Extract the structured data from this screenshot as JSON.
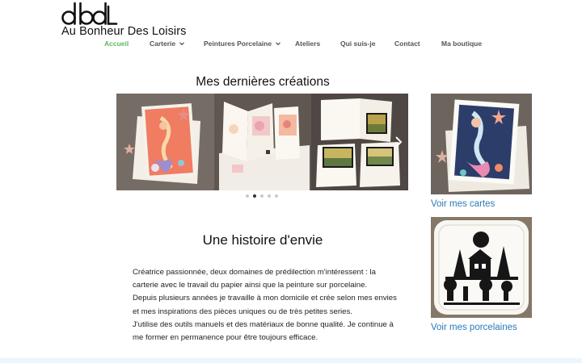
{
  "brand": {
    "logo_mark": "dbdL",
    "name": "Au Bonheur Des Loisirs"
  },
  "nav": {
    "items": [
      {
        "label": "Accueil",
        "active": true,
        "has_dropdown": false
      },
      {
        "label": "Carterie",
        "active": false,
        "has_dropdown": true
      },
      {
        "label": "Peintures Porcelaine",
        "active": false,
        "has_dropdown": true
      },
      {
        "label": "Ateliers",
        "active": false,
        "has_dropdown": false
      },
      {
        "label": "Qui suis-je",
        "active": false,
        "has_dropdown": false
      },
      {
        "label": "Contact",
        "active": false,
        "has_dropdown": false
      },
      {
        "label": "Ma boutique",
        "active": false,
        "has_dropdown": false
      }
    ],
    "active_color": "#5cb85c"
  },
  "creations": {
    "title": "Mes dernières créations",
    "dots_count": 5,
    "active_dot": 2,
    "next_icon": "chevron-right-icon"
  },
  "side": {
    "cards_link": "Voir mes cartes",
    "porcelain_link": "Voir mes porcelaines",
    "link_color": "#2a7ab8"
  },
  "story": {
    "title": "Une histoire d'envie",
    "paragraphs": [
      "Créatrice passionnée, deux domaines de prédilection m'intéressent : la carterie avec le travail du papier ainsi que la peinture sur porcelaine.",
      "Depuis plusieurs années je travaille à mon domicile et crée selon mes envies et mes inspirations des pièces uniques ou de très petites series.",
      "J'utilise des outils manuels et des matériaux de bonne qualité. Je continue à me former en permanence pour être toujours efficace."
    ]
  }
}
